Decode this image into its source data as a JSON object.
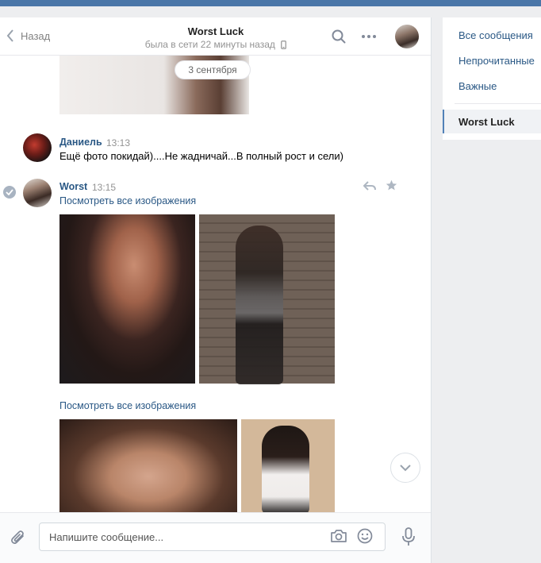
{
  "header": {
    "back_label": "Назад",
    "title": "Worst Luck",
    "status": "была в сети 22 минуты назад"
  },
  "feed": {
    "date_separator": "3 сентября",
    "messages": [
      {
        "author": "Даниель",
        "time": "13:13",
        "text": "Ещё фото покидай)....Не жадничай...В полный рост и сели)"
      },
      {
        "author": "Worst",
        "time": "13:15",
        "link1": "Посмотреть все изображения",
        "link2": "Посмотреть все изображения"
      }
    ]
  },
  "composer": {
    "placeholder": "Напишите сообщение..."
  },
  "sidebar": {
    "items": [
      {
        "label": "Все сообщения"
      },
      {
        "label": "Непрочитанные"
      },
      {
        "label": "Важные"
      }
    ],
    "active": {
      "label": "Worst Luck"
    }
  },
  "colors": {
    "accent": "#4a76a8",
    "link": "#2a5885",
    "background": "#edeef0"
  },
  "icons": [
    "back-chevron-icon",
    "search-icon",
    "more-icon",
    "phone-icon",
    "check-icon",
    "reply-icon",
    "star-icon",
    "chevron-down-icon",
    "paperclip-icon",
    "camera-icon",
    "smile-icon",
    "microphone-icon"
  ]
}
